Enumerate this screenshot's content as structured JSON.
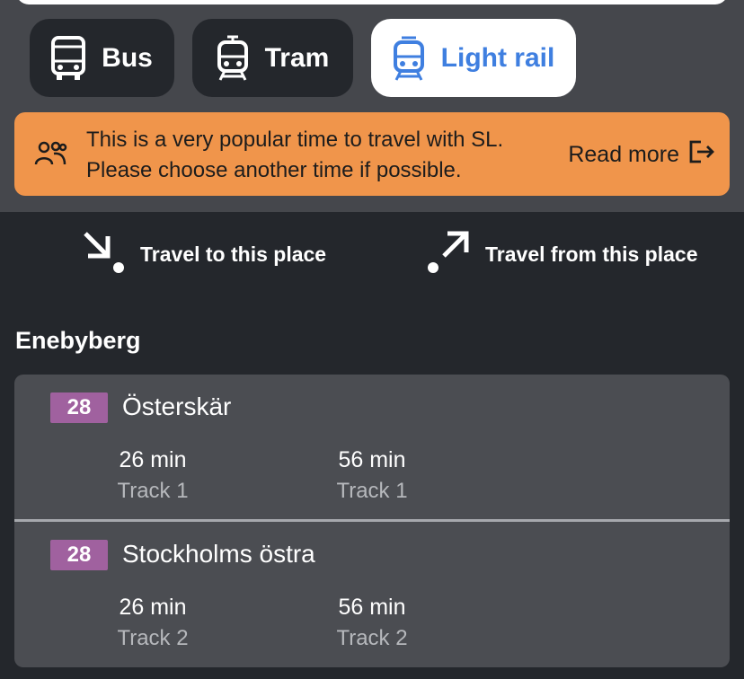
{
  "modes": {
    "bus": {
      "label": "Bus",
      "icon": "bus-icon"
    },
    "tram": {
      "label": "Tram",
      "icon": "tram-icon"
    },
    "light_rail": {
      "label": "Light rail",
      "icon": "light-rail-icon",
      "selected": true
    }
  },
  "notice": {
    "icon": "people-icon",
    "line1": "This is a very popular time to travel with SL.",
    "line2": "Please choose another time if possible.",
    "read_more": "Read more",
    "read_more_icon": "external-exit-icon",
    "color": "#f0954b"
  },
  "travel": {
    "to_label": "Travel to this place",
    "from_label": "Travel from this place"
  },
  "stop": {
    "name": "Enebyberg",
    "departures": [
      {
        "line": "28",
        "destination": "Österskär",
        "times": [
          {
            "time": "26 min",
            "track": "Track 1"
          },
          {
            "time": "56 min",
            "track": "Track 1"
          }
        ]
      },
      {
        "line": "28",
        "destination": "Stockholms östra",
        "times": [
          {
            "time": "26 min",
            "track": "Track 2"
          },
          {
            "time": "56 min",
            "track": "Track 2"
          }
        ]
      }
    ]
  },
  "colors": {
    "background": "#24272c",
    "panel": "#45474c",
    "card": "#4b4d52",
    "accent": "#3f7fe0",
    "line_badge": "#a0619f"
  }
}
